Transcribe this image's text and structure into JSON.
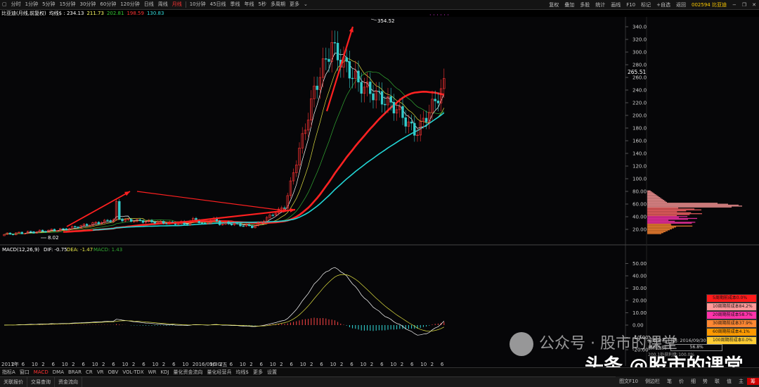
{
  "topbar": {
    "items": [
      "分时",
      "1分钟",
      "5分钟",
      "15分钟",
      "30分钟",
      "60分钟",
      "120分钟",
      "日线",
      "周线",
      "月线",
      "10分钟",
      "45日线",
      "季线",
      "年线",
      "5秒",
      "多周期",
      "更多"
    ],
    "active": "月线",
    "right_items": [
      "复权",
      "叠加",
      "多股",
      "统计",
      "画线",
      "F10",
      "标记",
      "+自选",
      "返回"
    ],
    "stock_code": "002594 比亚迪"
  },
  "infobar": {
    "name": "比亚迪(月线,前复权)",
    "ma_label": "均线$ : 234.13",
    "ma_values": [
      "211.73",
      "202.81",
      "198.59",
      "130.83"
    ],
    "ma_colors": [
      "#ffffff",
      "#dddd33",
      "#ff3333",
      "#33dddd"
    ]
  },
  "chart_data": {
    "type": "candlestick",
    "price_ticks": [
      "340.0",
      "320.0",
      "300.0",
      "280.0",
      "260.0",
      "240.0",
      "220.0",
      "200.0",
      "180.0",
      "160.0",
      "140.0",
      "120.0",
      "100.0",
      "80.00",
      "60.00",
      "40.00",
      "20.00"
    ],
    "current_price": "265.51",
    "high_label": "354.52",
    "low_label": "8.02",
    "macd": {
      "label": "MACD(12,26,9)",
      "dif": "DIF: -0.75",
      "dea": "DEA: -1.47",
      "macd": "MACD: 1.43",
      "ticks": [
        "50.00",
        "40.00",
        "30.00",
        "20.00",
        "10.00",
        "0.00",
        "-10.00",
        "-20.00"
      ]
    },
    "x_ticks": [
      "2011年",
      "2",
      "6",
      "10",
      "2",
      "6",
      "10",
      "2",
      "6",
      "10",
      "2",
      "6",
      "10",
      "2",
      "6",
      "10",
      "2",
      "6",
      "10",
      "2016/09/30/五",
      "10",
      "2",
      "6",
      "10",
      "2",
      "6",
      "10",
      "2",
      "6",
      "10",
      "2",
      "6",
      "10",
      "2",
      "6",
      "10",
      "2",
      "6",
      "10",
      "2",
      "6",
      "10",
      "2",
      "6"
    ]
  },
  "bottombar": {
    "items": [
      "指标A",
      "窗口",
      "MACD",
      "DMA",
      "BRAR",
      "CR",
      "VR",
      "OBV",
      "VOL-TDX",
      "WR",
      "KDJ",
      "量化资金流向",
      "量化经营兵",
      "均线$",
      "更多",
      "设置"
    ],
    "active": "MACD"
  },
  "statusbar": {
    "items": [
      "关联报价",
      "交易查询",
      "资金流向"
    ],
    "right_items": [
      "图文F10",
      "侧边栏",
      "笔",
      "价",
      "细",
      "势",
      "联",
      "值",
      "主",
      "筹"
    ]
  },
  "cost_legend": [
    {
      "label": "5周期前成本0.0%",
      "color": "#ff1a1a"
    },
    {
      "label": "10周期前成本84.2%",
      "color": "#ff9999"
    },
    {
      "label": "20周期前成本58.7%",
      "color": "#ff33aa"
    },
    {
      "label": "30周期前成本37.9%",
      "color": "#ff8833"
    },
    {
      "label": "60周期前成本4.1%",
      "color": "#ff9900"
    },
    {
      "label": "100周期前成本0.0%",
      "color": "#ffcc33"
    }
  ],
  "cost": {
    "title": "成本分布,日期: 2016/09/30",
    "profit_label": "获利比例:",
    "profit_value": "56.8%",
    "row2": "200.1处获利盘:100.0%"
  },
  "watermark": {
    "line1": "公众号 · 股市的课堂",
    "line2": "头条 @股市的课堂"
  }
}
